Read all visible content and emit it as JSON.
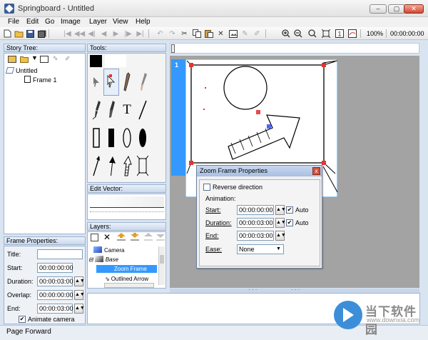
{
  "window": {
    "title": "Springboard - Untitled",
    "min_label": "–",
    "max_label": "▢",
    "close_label": "✕"
  },
  "menu": [
    "File",
    "Edit",
    "Go",
    "Image",
    "Layer",
    "View",
    "Help"
  ],
  "toolbar": {
    "zoom_value": "100%",
    "time_value": "00:00:00:00"
  },
  "story_tree": {
    "header": "Story Tree:",
    "root": "Untitled",
    "child": "Frame 1"
  },
  "tools": {
    "header": "Tools:",
    "text_tool_glyph": "T"
  },
  "edit_vector": {
    "header": "Edit Vector:"
  },
  "layers": {
    "header": "Layers:",
    "items": [
      {
        "label": "Camera"
      },
      {
        "label": "Base"
      },
      {
        "label": "Zoom Frame"
      },
      {
        "label": "Outlined Arrow"
      }
    ]
  },
  "frame_properties": {
    "header": "Frame Properties:",
    "title_label": "Title:",
    "title_value": "",
    "start_label": "Start:",
    "start_value": "00:00:00:00",
    "duration_label": "Duration:",
    "duration_value": "00:00:03:00",
    "overlap_label": "Overlap:",
    "overlap_value": "00:00:00:00",
    "end_label": "End:",
    "end_value": "00:00:03:00",
    "animate_camera_label": "Animate camera",
    "animate_camera_checked": true
  },
  "canvas": {
    "frame_number": "1"
  },
  "zoom_dialog": {
    "title": "Zoom Frame Properties",
    "close_label": "x",
    "reverse_label": "Reverse direction",
    "animation_label": "Animation:",
    "start_label": "Start:",
    "start_value": "00:00:00:00",
    "duration_label": "Duration:",
    "duration_value": "00:00:03:00",
    "end_label": "End:",
    "end_value": "00:00:03:00",
    "auto_label": "Auto",
    "ease_label": "Ease:",
    "ease_value": "None"
  },
  "status": {
    "text": "Page Forward"
  },
  "watermark": {
    "text": "当下软件园",
    "url": "www.downxia.com"
  },
  "colors": {
    "accent": "#3399ff",
    "panel_border": "#9fb3cf",
    "handle_red": "#e53333",
    "handle_blue": "#5566ee"
  }
}
